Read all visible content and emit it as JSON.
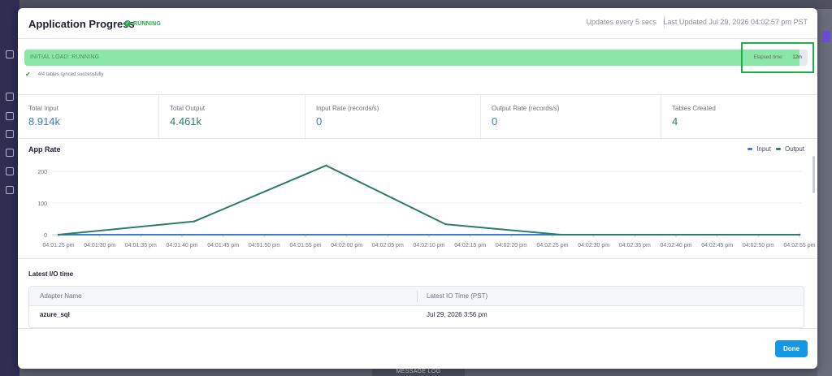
{
  "modal": {
    "title": "Application Progress",
    "status": "RUNNING",
    "updates_text": "Updates every 5 secs",
    "last_updated": "Last Updated Jul 29, 2026 04:02:57 pm PST"
  },
  "progress": {
    "label": "INITIAL LOAD: RUNNING",
    "elapsed_label": "Elapsed time:",
    "elapsed_value": "12m",
    "fill_fraction": 0.99,
    "synced_text": "4/4 tables synced successfully"
  },
  "stats": [
    {
      "label": "Total Input",
      "value": "8.914k",
      "color": "#3b7bd0"
    },
    {
      "label": "Total Output",
      "value": "4.461k",
      "color": "#2e7d6a"
    },
    {
      "label": "Input Rate (records/s)",
      "value": "0",
      "color": "#3b7bd0"
    },
    {
      "label": "Output Rate (records/s)",
      "value": "0",
      "color": "#3b7bd0"
    },
    {
      "label": "Tables Created",
      "value": "4",
      "color": "#2e7d6a"
    }
  ],
  "chart_data": {
    "type": "line",
    "title": "App Rate",
    "categories": [
      "04:01:25 pm",
      "04:01:30 pm",
      "04:01:35 pm",
      "04:01:40 pm",
      "04:01:45 pm",
      "04:01:50 pm",
      "04:01:55 pm",
      "04:02:00 pm",
      "04:02:05 pm",
      "04:02:10 pm",
      "04:02:15 pm",
      "04:02:20 pm",
      "04:02:25 pm",
      "04:02:30 pm",
      "04:02:35 pm",
      "04:02:40 pm",
      "04:02:45 pm",
      "04:02:50 pm",
      "04:02:55 pm"
    ],
    "yticks": [
      0,
      100,
      200
    ],
    "ylim": [
      0,
      220
    ],
    "legend_position": "top-right",
    "series": [
      {
        "name": "Input",
        "color": "#3b7bd0",
        "points": [
          [
            0,
            0
          ],
          [
            18,
            0
          ]
        ]
      },
      {
        "name": "Output",
        "color": "#2e7d6a",
        "points": [
          [
            0,
            0
          ],
          [
            3.3,
            42
          ],
          [
            6.5,
            218
          ],
          [
            9.4,
            33
          ],
          [
            12.2,
            0
          ],
          [
            18,
            0
          ]
        ]
      }
    ]
  },
  "io": {
    "title": "Latest I/O time",
    "col1": "Adapter Name",
    "col2": "Latest IO Time (PST)",
    "row_adapter": "azure_sql",
    "row_time": "Jul 29, 2026 3:56 pm"
  },
  "done_label": "Done",
  "message_log": "MESSAGE LOG"
}
